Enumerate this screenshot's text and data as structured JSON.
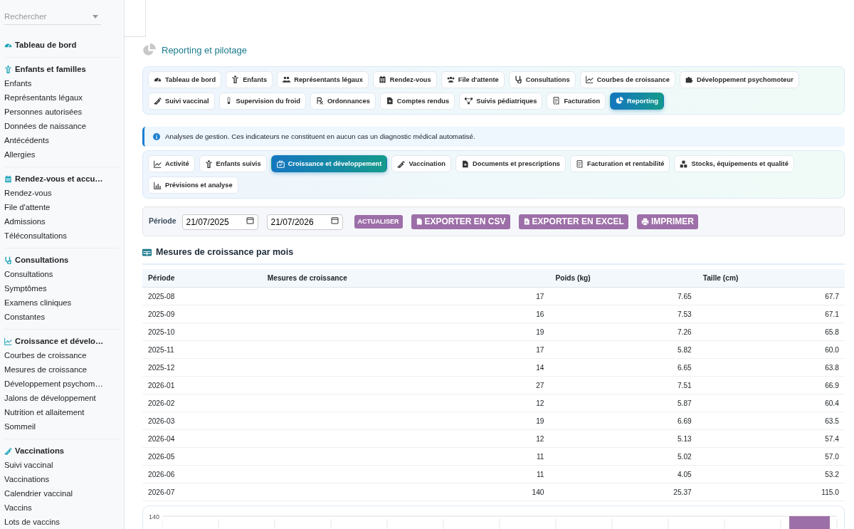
{
  "sidebar": {
    "search": {
      "placeholder": "Rechercher"
    },
    "sections": [
      {
        "title": "Tableau de bord"
      },
      {
        "title": "Enfants et familles",
        "items": [
          "Enfants",
          "Représentants légaux",
          "Personnes autorisées",
          "Données de naissance",
          "Antécédents",
          "Allergies"
        ]
      },
      {
        "title": "Rendez-vous et accu…",
        "items": [
          "Rendez-vous",
          "File d'attente",
          "Admissions",
          "Téléconsultations"
        ]
      },
      {
        "title": "Consultations",
        "items": [
          "Consultations",
          "Symptômes",
          "Examens cliniques",
          "Constantes"
        ]
      },
      {
        "title": "Croissance et dévelo…",
        "items": [
          "Courbes de croissance",
          "Mesures de croissance",
          "Développement psychom…",
          "Jalons de développement",
          "Nutrition et allaitement",
          "Sommeil"
        ]
      },
      {
        "title": "Vaccinations",
        "items": [
          "Suivi vaccinal",
          "Vaccinations",
          "Calendrier vaccinal",
          "Vaccins",
          "Lots de vaccins"
        ]
      }
    ]
  },
  "page": {
    "title": "Reporting et pilotage"
  },
  "module_tabs": [
    {
      "label": "Tableau de bord",
      "selected": false
    },
    {
      "label": "Enfants",
      "selected": false
    },
    {
      "label": "Représentants légaux",
      "selected": false
    },
    {
      "label": "Rendez-vous",
      "selected": false
    },
    {
      "label": "File d'attente",
      "selected": false
    },
    {
      "label": "Consultations",
      "selected": false
    },
    {
      "label": "Courbes de croissance",
      "selected": false
    },
    {
      "label": "Développement psychomoteur",
      "selected": false
    },
    {
      "label": "Suivi vaccinal",
      "selected": false
    },
    {
      "label": "Supervision du froid",
      "selected": false
    },
    {
      "label": "Ordonnances",
      "selected": false
    },
    {
      "label": "Comptes rendus",
      "selected": false
    },
    {
      "label": "Suivis pédiatriques",
      "selected": false
    },
    {
      "label": "Facturation",
      "selected": false
    },
    {
      "label": "Reporting",
      "selected": true
    }
  ],
  "alert": "Analyses de gestion. Ces indicateurs ne constituent en aucun cas un diagnostic médical automatisé.",
  "report_tabs": [
    {
      "label": "Activité",
      "selected": false
    },
    {
      "label": "Enfants suivis",
      "selected": false
    },
    {
      "label": "Croissance et développement",
      "selected": true
    },
    {
      "label": "Vaccination",
      "selected": false
    },
    {
      "label": "Documents et prescriptions",
      "selected": false
    },
    {
      "label": "Facturation et rentabilité",
      "selected": false
    },
    {
      "label": "Stocks, équipements et qualité",
      "selected": false
    },
    {
      "label": "Prévisions et analyse",
      "selected": false
    }
  ],
  "filters": {
    "label": "Période",
    "date_from": "21/07/2025",
    "date_to": "21/07/2026",
    "buttons": [
      {
        "label": "ACTUALISER",
        "kind": "small"
      },
      {
        "label": "EXPORTER EN CSV",
        "kind": "csv"
      },
      {
        "label": "EXPORTER EN EXCEL",
        "kind": "excel"
      },
      {
        "label": "IMPRIMER",
        "kind": "print"
      }
    ]
  },
  "table": {
    "title": "Mesures de croissance par mois",
    "columns": [
      "Période",
      "Mesures de croissance",
      "Poids (kg)",
      "Taille (cm)"
    ],
    "rows": [
      [
        "2025-08",
        "17",
        "7.65",
        "67.7"
      ],
      [
        "2025-09",
        "16",
        "7.53",
        "67.1"
      ],
      [
        "2025-10",
        "19",
        "7.26",
        "65.8"
      ],
      [
        "2025-11",
        "17",
        "5.82",
        "60.0"
      ],
      [
        "2025-12",
        "14",
        "6.65",
        "63.8"
      ],
      [
        "2026-01",
        "27",
        "7.51",
        "66.9"
      ],
      [
        "2026-02",
        "12",
        "5.87",
        "60.4"
      ],
      [
        "2026-03",
        "19",
        "6.69",
        "63.5"
      ],
      [
        "2026-04",
        "12",
        "5.13",
        "57.4"
      ],
      [
        "2026-05",
        "11",
        "5.02",
        "57.0"
      ],
      [
        "2026-06",
        "11",
        "4.05",
        "53.2"
      ],
      [
        "2026-07",
        "140",
        "25.37",
        "115.0"
      ]
    ]
  },
  "chart": {
    "y_tick": "140"
  }
}
